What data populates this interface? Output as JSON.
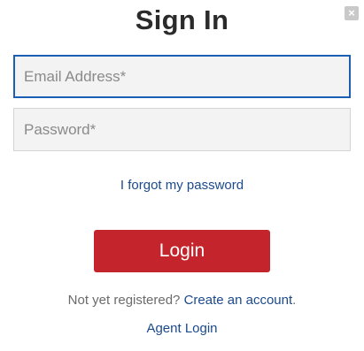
{
  "dialog": {
    "title": "Sign In",
    "close_icon": "close-icon"
  },
  "form": {
    "email": {
      "value": "",
      "placeholder": "Email Address*"
    },
    "password": {
      "value": "",
      "placeholder": "Password*"
    },
    "forgot_password_label": "I forgot my password",
    "login_label": "Login"
  },
  "footer": {
    "register_prompt": "Not yet registered?",
    "create_account_label": "Create an account",
    "register_suffix": ".",
    "agent_login_label": "Agent Login"
  },
  "colors": {
    "accent": "#c4252d",
    "link": "#1b4a8c",
    "focus_border": "#1a5fb4"
  }
}
